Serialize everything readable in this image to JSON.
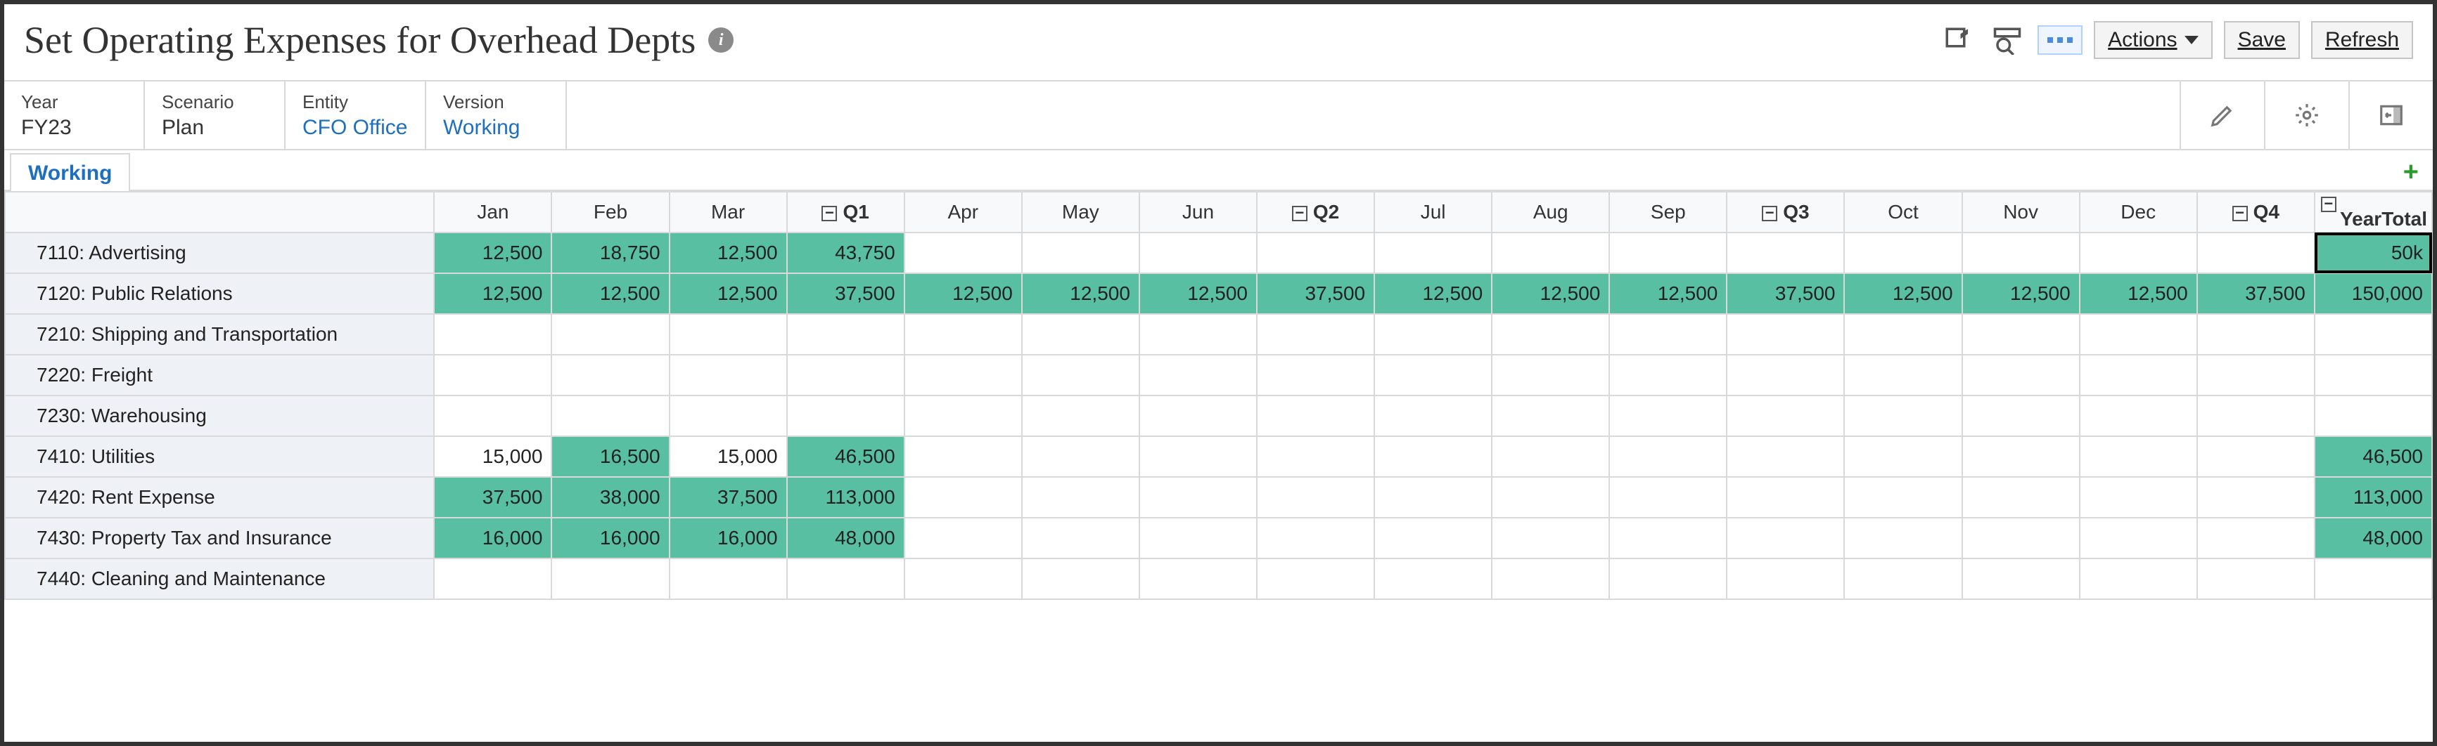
{
  "header": {
    "title": "Set Operating Expenses for Overhead Depts",
    "info_icon": "i",
    "actions_label": "Actions",
    "save_label": "Save",
    "refresh_label": "Refresh"
  },
  "pov": {
    "year": {
      "label": "Year",
      "value": "FY23",
      "link": false
    },
    "scenario": {
      "label": "Scenario",
      "value": "Plan",
      "link": false
    },
    "entity": {
      "label": "Entity",
      "value": "CFO Office",
      "link": true
    },
    "version": {
      "label": "Version",
      "value": "Working",
      "link": true
    }
  },
  "tabs": {
    "active": "Working"
  },
  "grid": {
    "columns": [
      "Jan",
      "Feb",
      "Mar",
      "Q1",
      "Apr",
      "May",
      "Jun",
      "Q2",
      "Jul",
      "Aug",
      "Sep",
      "Q3",
      "Oct",
      "Nov",
      "Dec",
      "Q4",
      "YearTotal"
    ],
    "quarter_cols": [
      "Q1",
      "Q2",
      "Q3",
      "Q4",
      "YearTotal"
    ],
    "rows": [
      {
        "label": "7110: Advertising",
        "cells": [
          {
            "v": "12,500",
            "hl": true
          },
          {
            "v": "18,750",
            "hl": true
          },
          {
            "v": "12,500",
            "hl": true
          },
          {
            "v": "43,750",
            "hl": true
          },
          {
            "v": ""
          },
          {
            "v": ""
          },
          {
            "v": ""
          },
          {
            "v": ""
          },
          {
            "v": ""
          },
          {
            "v": ""
          },
          {
            "v": ""
          },
          {
            "v": ""
          },
          {
            "v": ""
          },
          {
            "v": ""
          },
          {
            "v": ""
          },
          {
            "v": ""
          },
          {
            "v": "50k",
            "hl": true,
            "sel": true
          }
        ]
      },
      {
        "label": "7120: Public Relations",
        "cells": [
          {
            "v": "12,500",
            "hl": true
          },
          {
            "v": "12,500",
            "hl": true
          },
          {
            "v": "12,500",
            "hl": true
          },
          {
            "v": "37,500",
            "hl": true
          },
          {
            "v": "12,500",
            "hl": true
          },
          {
            "v": "12,500",
            "hl": true
          },
          {
            "v": "12,500",
            "hl": true
          },
          {
            "v": "37,500",
            "hl": true
          },
          {
            "v": "12,500",
            "hl": true
          },
          {
            "v": "12,500",
            "hl": true
          },
          {
            "v": "12,500",
            "hl": true
          },
          {
            "v": "37,500",
            "hl": true
          },
          {
            "v": "12,500",
            "hl": true
          },
          {
            "v": "12,500",
            "hl": true
          },
          {
            "v": "12,500",
            "hl": true
          },
          {
            "v": "37,500",
            "hl": true
          },
          {
            "v": "150,000",
            "hl": true
          }
        ]
      },
      {
        "label": "7210: Shipping and Transportation",
        "cells": [
          {
            "v": ""
          },
          {
            "v": ""
          },
          {
            "v": ""
          },
          {
            "v": ""
          },
          {
            "v": ""
          },
          {
            "v": ""
          },
          {
            "v": ""
          },
          {
            "v": ""
          },
          {
            "v": ""
          },
          {
            "v": ""
          },
          {
            "v": ""
          },
          {
            "v": ""
          },
          {
            "v": ""
          },
          {
            "v": ""
          },
          {
            "v": ""
          },
          {
            "v": ""
          },
          {
            "v": ""
          }
        ]
      },
      {
        "label": "7220: Freight",
        "cells": [
          {
            "v": ""
          },
          {
            "v": ""
          },
          {
            "v": ""
          },
          {
            "v": ""
          },
          {
            "v": ""
          },
          {
            "v": ""
          },
          {
            "v": ""
          },
          {
            "v": ""
          },
          {
            "v": ""
          },
          {
            "v": ""
          },
          {
            "v": ""
          },
          {
            "v": ""
          },
          {
            "v": ""
          },
          {
            "v": ""
          },
          {
            "v": ""
          },
          {
            "v": ""
          },
          {
            "v": ""
          }
        ]
      },
      {
        "label": "7230: Warehousing",
        "cells": [
          {
            "v": ""
          },
          {
            "v": ""
          },
          {
            "v": ""
          },
          {
            "v": ""
          },
          {
            "v": ""
          },
          {
            "v": ""
          },
          {
            "v": ""
          },
          {
            "v": ""
          },
          {
            "v": ""
          },
          {
            "v": ""
          },
          {
            "v": ""
          },
          {
            "v": ""
          },
          {
            "v": ""
          },
          {
            "v": ""
          },
          {
            "v": ""
          },
          {
            "v": ""
          },
          {
            "v": ""
          }
        ]
      },
      {
        "label": "7410: Utilities",
        "cells": [
          {
            "v": "15,000"
          },
          {
            "v": "16,500",
            "hl": true
          },
          {
            "v": "15,000"
          },
          {
            "v": "46,500",
            "hl": true
          },
          {
            "v": ""
          },
          {
            "v": ""
          },
          {
            "v": ""
          },
          {
            "v": ""
          },
          {
            "v": ""
          },
          {
            "v": ""
          },
          {
            "v": ""
          },
          {
            "v": ""
          },
          {
            "v": ""
          },
          {
            "v": ""
          },
          {
            "v": ""
          },
          {
            "v": ""
          },
          {
            "v": "46,500",
            "hl": true
          }
        ]
      },
      {
        "label": "7420: Rent Expense",
        "cells": [
          {
            "v": "37,500",
            "hl": true
          },
          {
            "v": "38,000",
            "hl": true
          },
          {
            "v": "37,500",
            "hl": true
          },
          {
            "v": "113,000",
            "hl": true
          },
          {
            "v": ""
          },
          {
            "v": ""
          },
          {
            "v": ""
          },
          {
            "v": ""
          },
          {
            "v": ""
          },
          {
            "v": ""
          },
          {
            "v": ""
          },
          {
            "v": ""
          },
          {
            "v": ""
          },
          {
            "v": ""
          },
          {
            "v": ""
          },
          {
            "v": ""
          },
          {
            "v": "113,000",
            "hl": true
          }
        ]
      },
      {
        "label": "7430: Property Tax and Insurance",
        "cells": [
          {
            "v": "16,000",
            "hl": true
          },
          {
            "v": "16,000",
            "hl": true
          },
          {
            "v": "16,000",
            "hl": true
          },
          {
            "v": "48,000",
            "hl": true
          },
          {
            "v": ""
          },
          {
            "v": ""
          },
          {
            "v": ""
          },
          {
            "v": ""
          },
          {
            "v": ""
          },
          {
            "v": ""
          },
          {
            "v": ""
          },
          {
            "v": ""
          },
          {
            "v": ""
          },
          {
            "v": ""
          },
          {
            "v": ""
          },
          {
            "v": ""
          },
          {
            "v": "48,000",
            "hl": true
          }
        ]
      },
      {
        "label": "7440: Cleaning and Maintenance",
        "cells": [
          {
            "v": ""
          },
          {
            "v": ""
          },
          {
            "v": ""
          },
          {
            "v": ""
          },
          {
            "v": ""
          },
          {
            "v": ""
          },
          {
            "v": ""
          },
          {
            "v": ""
          },
          {
            "v": ""
          },
          {
            "v": ""
          },
          {
            "v": ""
          },
          {
            "v": ""
          },
          {
            "v": ""
          },
          {
            "v": ""
          },
          {
            "v": ""
          },
          {
            "v": ""
          },
          {
            "v": ""
          }
        ]
      }
    ]
  },
  "chart_data": {
    "type": "table",
    "title": "Set Operating Expenses for Overhead Depts",
    "columns": [
      "Jan",
      "Feb",
      "Mar",
      "Q1",
      "Apr",
      "May",
      "Jun",
      "Q2",
      "Jul",
      "Aug",
      "Sep",
      "Q3",
      "Oct",
      "Nov",
      "Dec",
      "Q4",
      "YearTotal"
    ],
    "rows": {
      "7110: Advertising": [
        12500,
        18750,
        12500,
        43750,
        null,
        null,
        null,
        null,
        null,
        null,
        null,
        null,
        null,
        null,
        null,
        null,
        50000
      ],
      "7120: Public Relations": [
        12500,
        12500,
        12500,
        37500,
        12500,
        12500,
        12500,
        37500,
        12500,
        12500,
        12500,
        37500,
        12500,
        12500,
        12500,
        37500,
        150000
      ],
      "7210: Shipping and Transportation": [
        null,
        null,
        null,
        null,
        null,
        null,
        null,
        null,
        null,
        null,
        null,
        null,
        null,
        null,
        null,
        null,
        null
      ],
      "7220: Freight": [
        null,
        null,
        null,
        null,
        null,
        null,
        null,
        null,
        null,
        null,
        null,
        null,
        null,
        null,
        null,
        null,
        null
      ],
      "7230: Warehousing": [
        null,
        null,
        null,
        null,
        null,
        null,
        null,
        null,
        null,
        null,
        null,
        null,
        null,
        null,
        null,
        null,
        null
      ],
      "7410: Utilities": [
        15000,
        16500,
        15000,
        46500,
        null,
        null,
        null,
        null,
        null,
        null,
        null,
        null,
        null,
        null,
        null,
        null,
        46500
      ],
      "7420: Rent Expense": [
        37500,
        38000,
        37500,
        113000,
        null,
        null,
        null,
        null,
        null,
        null,
        null,
        null,
        null,
        null,
        null,
        null,
        113000
      ],
      "7430: Property Tax and Insurance": [
        16000,
        16000,
        16000,
        48000,
        null,
        null,
        null,
        null,
        null,
        null,
        null,
        null,
        null,
        null,
        null,
        null,
        48000
      ],
      "7440: Cleaning and Maintenance": [
        null,
        null,
        null,
        null,
        null,
        null,
        null,
        null,
        null,
        null,
        null,
        null,
        null,
        null,
        null,
        null,
        null
      ]
    },
    "note_cell_display": {
      "row": "7110: Advertising",
      "col": "YearTotal",
      "display": "50k"
    }
  }
}
